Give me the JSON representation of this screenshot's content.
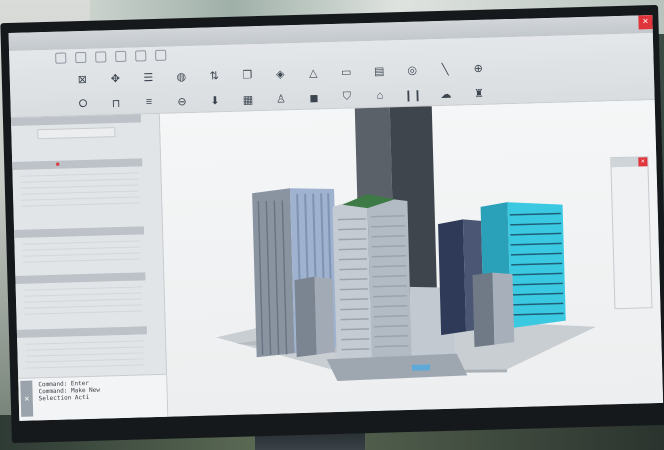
{
  "app": {
    "window_title": ""
  },
  "menu": {
    "items": [
      "",
      "",
      "",
      "",
      "",
      "",
      "",
      "",
      ""
    ]
  },
  "ribbon": {
    "label": "",
    "row1_icons": [
      "select-icon",
      "move-icon",
      "stack-icon",
      "sphere-icon",
      "align-icon",
      "copy-icon",
      "layers-icon",
      "triangle-icon",
      "box-icon",
      "page-icon",
      "circle-icon",
      "line-icon",
      "target-icon"
    ],
    "row2_icons": [
      "rotate-icon",
      "frame-icon",
      "split-icon",
      "globe-icon",
      "arrow-down-icon",
      "grid-icon",
      "user-icon",
      "cube-icon",
      "shield-icon",
      "house-icon",
      "columns-icon",
      "cloud-icon",
      "tower-icon"
    ],
    "right_labels": [
      "",
      "",
      "",
      "",
      "",
      "",
      "",
      "",
      ""
    ]
  },
  "left_panel": {
    "sections": [
      "",
      "",
      "",
      "",
      "",
      ""
    ]
  },
  "command_line": {
    "lines": [
      "Command: Enter",
      "Command: Make New",
      "Selection Acti"
    ]
  },
  "palette": {
    "items": [
      "",
      "",
      "",
      "",
      "",
      "",
      "",
      "",
      "",
      "",
      "",
      "",
      "",
      "",
      "",
      ""
    ]
  },
  "colors": {
    "accent": "#2f72c4",
    "close_red": "#e0353b",
    "building_cyan": "#3ac9e0",
    "roof_green": "#3d7a45"
  }
}
